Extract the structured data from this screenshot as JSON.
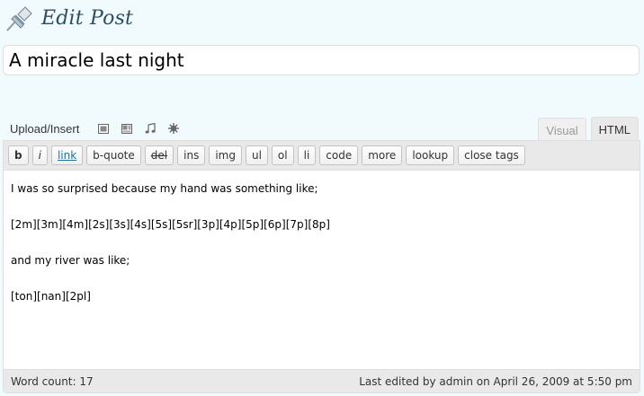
{
  "page": {
    "title": "Edit Post",
    "icon": "pushpin-icon"
  },
  "post": {
    "title_value": "A miracle last night"
  },
  "media": {
    "label": "Upload/Insert",
    "icons": [
      "image-icon",
      "video-icon",
      "audio-icon",
      "media-icon"
    ]
  },
  "tabs": {
    "visual": "Visual",
    "html": "HTML",
    "active": "HTML"
  },
  "quicktags": {
    "bold": "b",
    "italic": "i",
    "link": "link",
    "bquote": "b-quote",
    "del": "del",
    "ins": "ins",
    "img": "img",
    "ul": "ul",
    "ol": "ol",
    "li": "li",
    "code": "code",
    "more": "more",
    "lookup": "lookup",
    "close_tags": "close tags"
  },
  "content": {
    "line1": "I was so surprised because my hand was something like;",
    "line2": "[2m][3m][4m][2s][3s][4s][5s][5sr][3p][4p][5p][6p][7p][8p]",
    "line3": "and my river was like;",
    "line4": "[ton][nan][2pl]"
  },
  "status": {
    "word_count": "Word count: 17",
    "last_edited": "Last edited by admin on April 26, 2009 at 5:50 pm"
  },
  "colors": {
    "background": "#f1fafd",
    "title_text": "#2e4e5e",
    "link": "#21759b"
  }
}
